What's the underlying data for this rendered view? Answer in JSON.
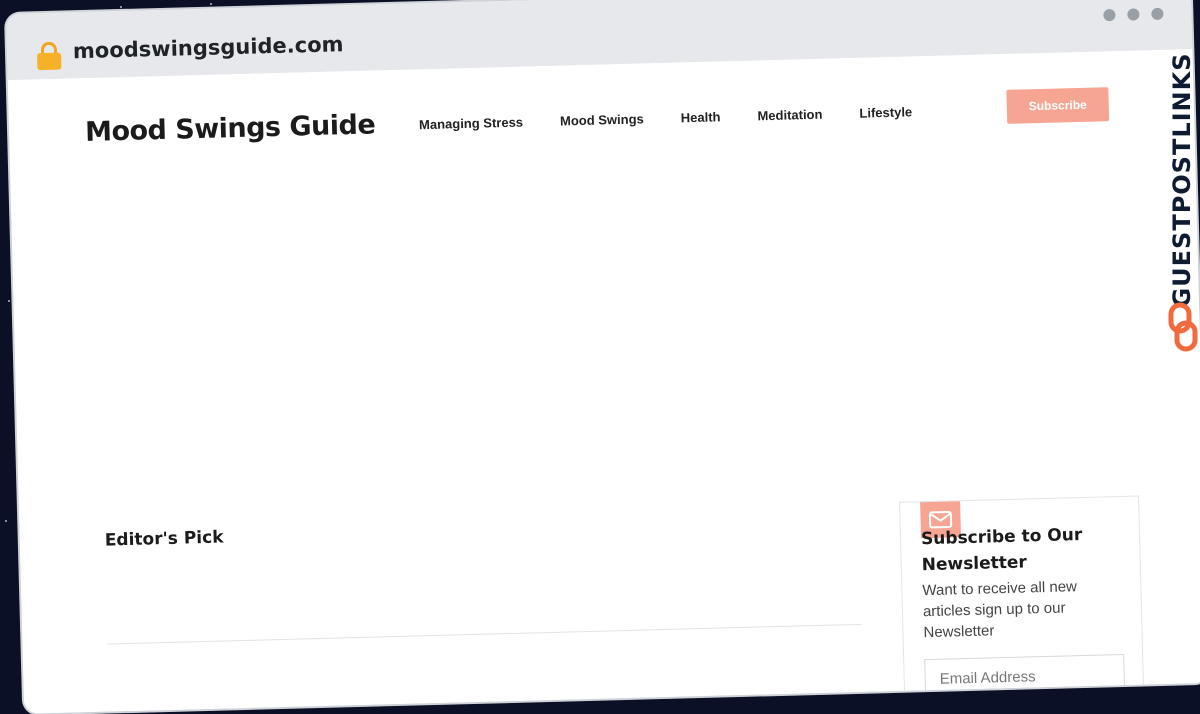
{
  "browser": {
    "url": "moodswingsguide.com",
    "lock_icon": "lock-icon",
    "window_controls": [
      "dot",
      "dot",
      "dot"
    ]
  },
  "site": {
    "title": "Mood Swings Guide",
    "nav": [
      "Managing Stress",
      "Mood Swings",
      "Health",
      "Meditation",
      "Lifestyle"
    ],
    "subscribe_label": "Subscribe"
  },
  "main": {
    "editors_pick": "Editor's Pick"
  },
  "newsletter": {
    "icon": "mail-icon",
    "title": "Subscribe to Our Newsletter",
    "text": "Want to receive all new articles sign up to our Newsletter",
    "email_placeholder": "Email Address"
  },
  "watermark": {
    "text": "GUESTPOSTLINKS",
    "icon": "link-logo-icon"
  },
  "colors": {
    "accent": "#f6a593",
    "background": "#0b1026",
    "watermark_text": "#0f1a33",
    "watermark_logo": "#f26a3d"
  }
}
